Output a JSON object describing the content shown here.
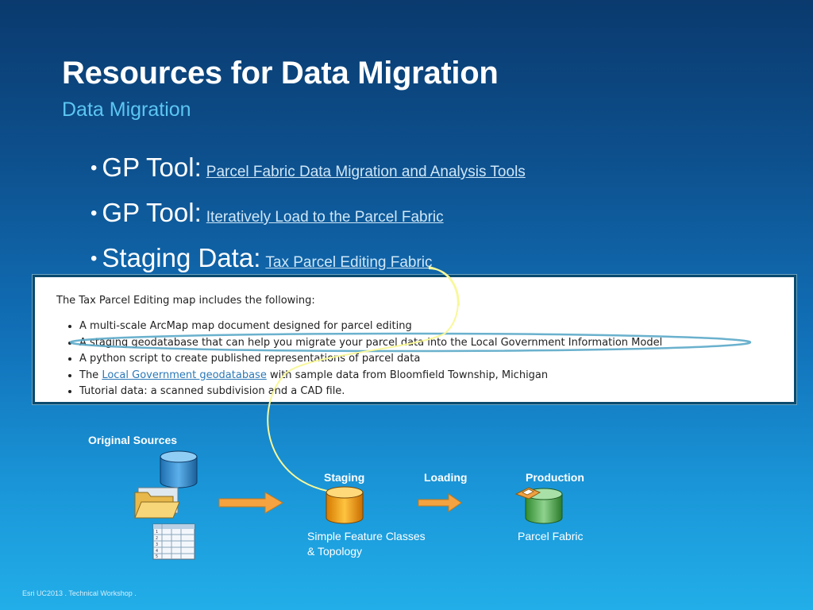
{
  "slide": {
    "title": "Resources for Data Migration",
    "subtitle": "Data Migration",
    "bullets": [
      {
        "label": "GP Tool:",
        "link": "Parcel Fabric Data Migration and Analysis Tools"
      },
      {
        "label": "GP Tool:",
        "link": "Iteratively Load to the Parcel Fabric"
      },
      {
        "label": "Staging Data:",
        "link": "Tax Parcel Editing Fabric"
      }
    ]
  },
  "web_excerpt": {
    "intro": "The Tax Parcel Editing map includes the following:",
    "items": [
      {
        "text": "A multi-scale ArcMap map document designed for parcel editing"
      },
      {
        "text": "A staging geodatabase that can help you migrate your parcel data into the Local Government Information Model"
      },
      {
        "text": "A python script to create published representations of parcel data"
      },
      {
        "prefix": "The ",
        "link": "Local Government geodatabase",
        "suffix": " with sample data from Bloomfield Township, Michigan"
      },
      {
        "text": "Tutorial data: a scanned subdivision and a CAD file."
      }
    ]
  },
  "workflow": {
    "original_sources": "Original Sources",
    "staging": "Staging",
    "loading": "Loading",
    "production": "Production",
    "staging_caption_line1": "Simple Feature Classes",
    "staging_caption_line2": "& Topology",
    "production_caption": "Parcel Fabric"
  },
  "footer": "Esri UC2013 . Technical Workshop .",
  "colors": {
    "highlight": "#f8f89a",
    "arrow": "#f5a340",
    "staging_db": "#f5a000",
    "source_db": "#3b8fd0",
    "fabric": "#5cb85c"
  }
}
